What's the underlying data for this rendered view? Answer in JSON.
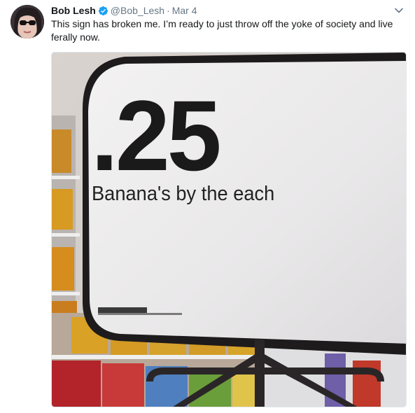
{
  "tweet": {
    "author_name": "Bob Lesh",
    "handle": "@Bob_Lesh",
    "separator": "·",
    "date": "Mar 4",
    "text": "This sign has broken me. I’m ready to just throw off the yoke of society and live ferally now.",
    "verified": true
  },
  "icons": {
    "verified": "verified-badge-icon",
    "menu": "chevron-down-icon"
  },
  "colors": {
    "text": "#14171a",
    "secondary": "#657786",
    "verified": "#1da1f2"
  },
  "media": {
    "sign_price": ".25",
    "sign_caption": "Banana's by the each"
  }
}
